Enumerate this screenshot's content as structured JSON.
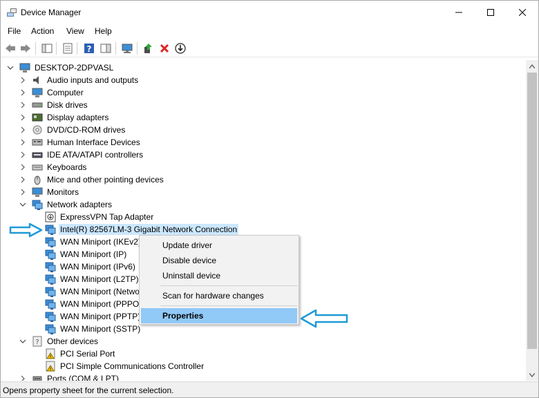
{
  "window": {
    "title": "Device Manager"
  },
  "menubar": {
    "items": [
      "File",
      "Action",
      "View",
      "Help"
    ]
  },
  "tree": {
    "root": "DESKTOP-2DPVASL",
    "nodes": [
      {
        "label": "Audio inputs and outputs",
        "icon": "speaker-icon"
      },
      {
        "label": "Computer",
        "icon": "computer-icon"
      },
      {
        "label": "Disk drives",
        "icon": "disk-drive-icon"
      },
      {
        "label": "Display adapters",
        "icon": "display-adapter-icon"
      },
      {
        "label": "DVD/CD-ROM drives",
        "icon": "dvd-drive-icon"
      },
      {
        "label": "Human Interface Devices",
        "icon": "hid-icon"
      },
      {
        "label": "IDE ATA/ATAPI controllers",
        "icon": "ide-controller-icon"
      },
      {
        "label": "Keyboards",
        "icon": "keyboard-icon"
      },
      {
        "label": "Mice and other pointing devices",
        "icon": "mouse-icon"
      },
      {
        "label": "Monitors",
        "icon": "monitor-icon"
      },
      {
        "label": "Network adapters",
        "icon": "network-adapter-icon"
      },
      {
        "label": "ExpressVPN Tap Adapter",
        "icon": "vpn-adapter-icon"
      },
      {
        "label": "Intel(R) 82567LM-3 Gigabit Network Connection",
        "icon": "network-adapter-icon"
      },
      {
        "label": "WAN Miniport (IKEv2)",
        "icon": "network-adapter-icon"
      },
      {
        "label": "WAN Miniport (IP)",
        "icon": "network-adapter-icon"
      },
      {
        "label": "WAN Miniport (IPv6)",
        "icon": "network-adapter-icon"
      },
      {
        "label": "WAN Miniport (L2TP)",
        "icon": "network-adapter-icon"
      },
      {
        "label": "WAN Miniport (Netwo",
        "icon": "network-adapter-icon"
      },
      {
        "label": "WAN Miniport (PPPOI",
        "icon": "network-adapter-icon"
      },
      {
        "label": "WAN Miniport (PPTP)",
        "icon": "network-adapter-icon"
      },
      {
        "label": "WAN Miniport (SSTP)",
        "icon": "network-adapter-icon"
      },
      {
        "label": "Other devices",
        "icon": "unknown-device-icon"
      },
      {
        "label": "PCI Serial Port",
        "icon": "warning-device-icon"
      },
      {
        "label": "PCI Simple Communications Controller",
        "icon": "warning-device-icon"
      },
      {
        "label": "Ports (COM & LPT)",
        "icon": "port-icon"
      }
    ]
  },
  "context_menu": {
    "update_driver": "Update driver",
    "disable_device": "Disable device",
    "uninstall_device": "Uninstall device",
    "scan_hardware": "Scan for hardware changes",
    "properties": "Properties"
  },
  "status": {
    "text": "Opens property sheet for the current selection."
  },
  "colors": {
    "selection": "#cce8ff",
    "menu_highlight": "#91c9f7",
    "annotation_arrow": "#1e9ad6"
  }
}
